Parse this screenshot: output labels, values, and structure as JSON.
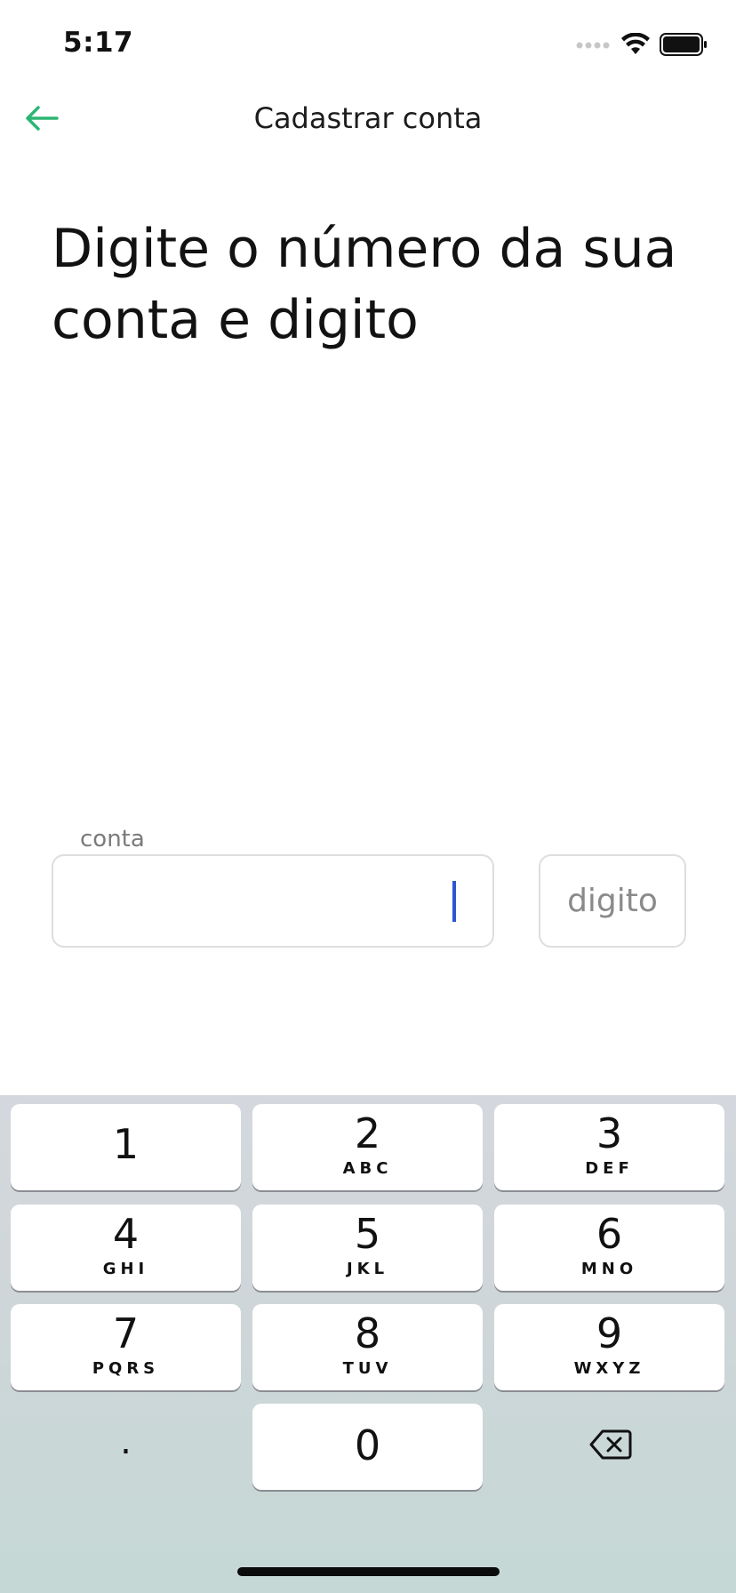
{
  "status_bar": {
    "time": "5:17"
  },
  "header": {
    "title": "Cadastrar conta"
  },
  "heading": {
    "line1": "Digite o número da sua",
    "line2": "conta e digito"
  },
  "form": {
    "conta_label": "conta",
    "conta_value": "",
    "digito_placeholder": "digito"
  },
  "keyboard": {
    "keys": [
      {
        "digit": "1",
        "letters": ""
      },
      {
        "digit": "2",
        "letters": "ABC"
      },
      {
        "digit": "3",
        "letters": "DEF"
      },
      {
        "digit": "4",
        "letters": "GHI"
      },
      {
        "digit": "5",
        "letters": "JKL"
      },
      {
        "digit": "6",
        "letters": "MNO"
      },
      {
        "digit": "7",
        "letters": "PQRS"
      },
      {
        "digit": "8",
        "letters": "TUV"
      },
      {
        "digit": "9",
        "letters": "WXYZ"
      }
    ],
    "dot": ".",
    "zero": "0"
  },
  "icons": {
    "back": "arrow-left-icon",
    "delete": "backspace-icon",
    "wifi": "wifi-icon",
    "battery": "battery-icon",
    "signal": "signal-icon"
  },
  "colors": {
    "accent": "#2bb673",
    "caret": "#2f55d4",
    "keyboard_bg": "#cfd6d9",
    "field_border": "#dedede"
  }
}
